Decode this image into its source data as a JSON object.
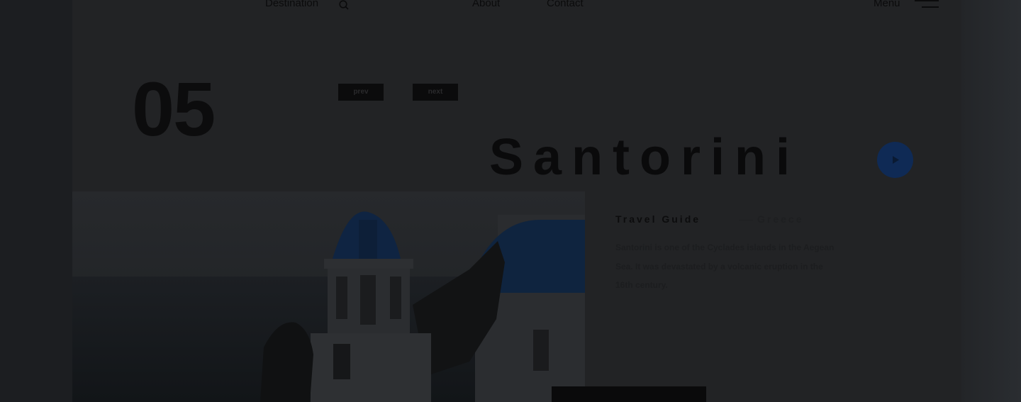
{
  "nav": {
    "links": [
      "Destination",
      "About",
      "Contact"
    ],
    "menu_label": "Menu"
  },
  "slide": {
    "number": "05",
    "prev_label": "prev",
    "next_label": "next"
  },
  "destination": {
    "title": "Santorini",
    "subtitle": "Travel Guide",
    "country": "Greece",
    "description": "Santorini is one of the Cyclades islands in the Aegean Sea. It was devastated by a volcanic eruption in the 16th century."
  },
  "colors": {
    "overlay_bg": "#222325",
    "accent_blue": "#0f2a55",
    "text_dark": "#0b0b0c"
  },
  "icons": [
    "search-icon",
    "menu-icon",
    "play-icon"
  ]
}
